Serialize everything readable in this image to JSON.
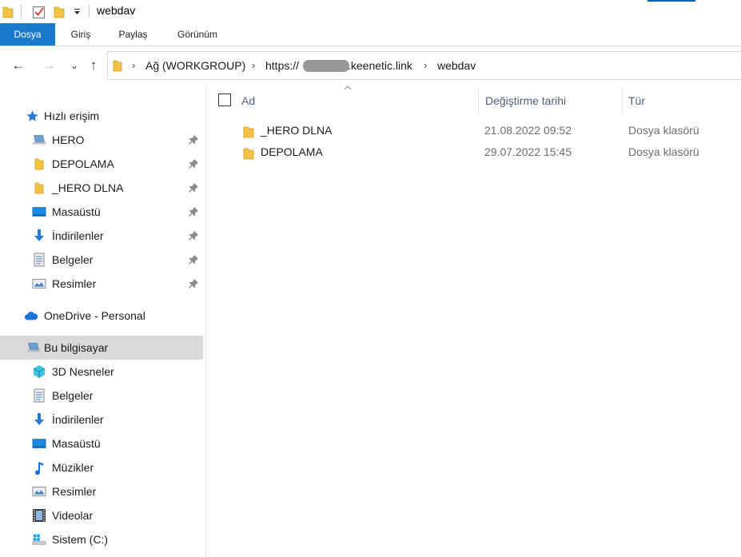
{
  "window": {
    "title": "webdav",
    "quick_access_icons": [
      "folder-icon",
      "properties-checkmark-icon",
      "new-folder-icon",
      "customize-dropdown-icon"
    ]
  },
  "ribbon": {
    "tabs": [
      {
        "label": "Dosya"
      },
      {
        "label": "Giriş"
      },
      {
        "label": "Paylaş"
      },
      {
        "label": "Görünüm"
      }
    ]
  },
  "address": {
    "back_icon": "←",
    "forward_icon": "→",
    "recent_icon": "⌄",
    "up_icon": "↑",
    "crumbs": [
      {
        "label": "Ağ (WORKGROUP)"
      },
      {
        "label": "https://"
      },
      {
        "label": ".keenetic.link"
      },
      {
        "label": "webdav"
      }
    ]
  },
  "sidebar": {
    "quick_access": {
      "label": "Hızlı erişim"
    },
    "pinned": [
      {
        "label": "HERO",
        "icon": "network-computer-icon"
      },
      {
        "label": "DEPOLAMA",
        "icon": "folder-icon"
      },
      {
        "label": "_HERO DLNA",
        "icon": "folder-icon"
      },
      {
        "label": "Masaüstü",
        "icon": "desktop-icon"
      },
      {
        "label": "İndirilenler",
        "icon": "downloads-icon"
      },
      {
        "label": "Belgeler",
        "icon": "documents-icon"
      },
      {
        "label": "Resimler",
        "icon": "pictures-icon"
      }
    ],
    "onedrive": {
      "label": "OneDrive - Personal"
    },
    "this_pc": {
      "label": "Bu bilgisayar"
    },
    "pc_items": [
      {
        "label": "3D Nesneler",
        "icon": "3d-objects-icon"
      },
      {
        "label": "Belgeler",
        "icon": "documents-icon"
      },
      {
        "label": "İndirilenler",
        "icon": "downloads-icon"
      },
      {
        "label": "Masaüstü",
        "icon": "desktop-icon"
      },
      {
        "label": "Müzikler",
        "icon": "music-icon"
      },
      {
        "label": "Resimler",
        "icon": "pictures-icon"
      },
      {
        "label": "Videolar",
        "icon": "videos-icon"
      },
      {
        "label": "Sistem (C:)",
        "icon": "system-drive-icon"
      }
    ]
  },
  "file_list": {
    "columns": {
      "name": "Ad",
      "modified": "Değiştirme tarihi",
      "type": "Tür"
    },
    "rows": [
      {
        "name": "_HERO DLNA",
        "modified": "21.08.2022 09:52",
        "type": "Dosya klasörü"
      },
      {
        "name": "DEPOLAMA",
        "modified": "29.07.2022 15:45",
        "type": "Dosya klasörü"
      }
    ]
  },
  "colors": {
    "file_tab": "#1979ca",
    "folder_yellow": "#f3c245",
    "selected_bg": "#d9d9d9",
    "header_text": "#4c607a",
    "pin": "#8a8a8a"
  }
}
